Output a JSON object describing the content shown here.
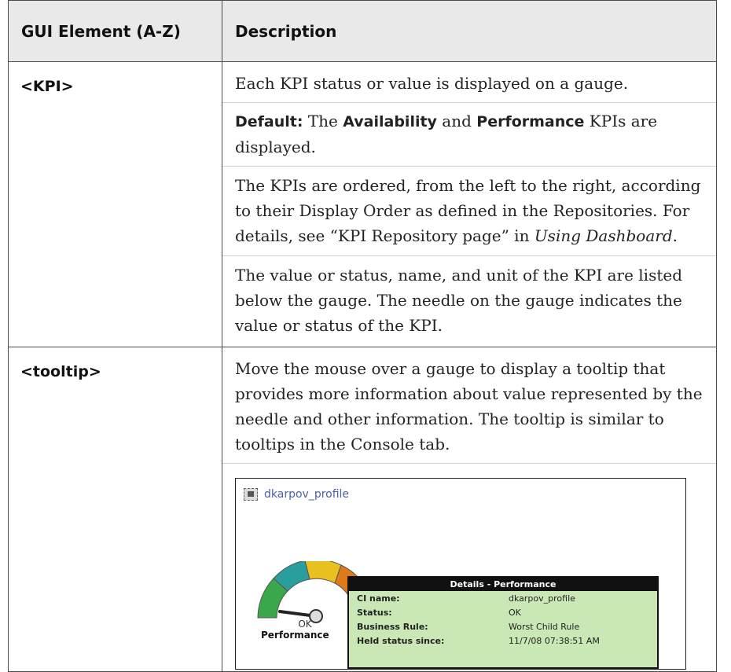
{
  "header": {
    "col1": "GUI Element (A-Z)",
    "col2": "Description"
  },
  "rows": [
    {
      "element": "<KPI>",
      "p1": "Each KPI status or value is displayed on a gauge.",
      "p2": {
        "label": "Default:",
        "t1": " The ",
        "b1": "Availability",
        "t2": " and ",
        "b2": "Performance",
        "t3": " KPIs are displayed."
      },
      "p3": {
        "text": "The KPIs are ordered, from the left to the right, according to their Display Order as defined in the Repositories. For details, see “KPI Repository page” in ",
        "italic": "Using Dashboard",
        "end": "."
      },
      "p4": "The value or status, name, and unit of the KPI are listed below the gauge. The needle on the gauge indicates the value or status of the KPI."
    },
    {
      "element": "<tooltip>",
      "p1": "Move the mouse over a gauge to display a tooltip that provides more information about value represented by the needle and other information. The tooltip is similar to tooltips in the Console tab."
    }
  ],
  "screenshot": {
    "title": "dkarpov_profile",
    "gauge_status": "OK",
    "gauge_name": "Performance",
    "gauge_colors": [
      "#3aa84a",
      "#2a9d9d",
      "#e8c020",
      "#e07a18",
      "#d42020"
    ],
    "tooltip": {
      "header": "Details - Performance",
      "rows": [
        {
          "key": "CI name:",
          "value": "dkarpov_profile"
        },
        {
          "key": "Status:",
          "value": "OK"
        },
        {
          "key": "Business Rule:",
          "value": "Worst Child Rule"
        },
        {
          "key": "Held status since:",
          "value": "11/7/08 07:38:51 AM"
        }
      ]
    }
  }
}
